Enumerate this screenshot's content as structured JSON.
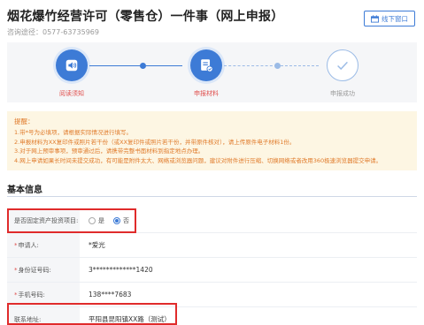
{
  "header": {
    "title": "烟花爆竹经营许可（零售仓）一件事（网上申报）",
    "consult_label": "咨询途径：",
    "consult_phone": "0577-63735969",
    "offline_button": "线下窗口"
  },
  "steps": [
    {
      "label": "阅读须知",
      "state": "done",
      "icon": "speaker-icon"
    },
    {
      "label": "申报材料",
      "state": "done",
      "icon": "document-edit-icon"
    },
    {
      "label": "申报成功",
      "state": "pending",
      "icon": "check-icon"
    }
  ],
  "notice": {
    "heading": "提醒：",
    "lines": [
      "1.带*号为必填项，请根据实际情况进行填写。",
      "2.申报材料为XX复印件或照片若干份（或XX复印件或照片若干份，并带原件核对），请上传原件电子材料1份。",
      "3.对于网上预审事项，预审通过后，请携带完整书面材料到指定地点办理。",
      "4.网上申请如果长时间未提交成功，有可能是附件太大、网络或浏览器问题，建议对附件进行压缩、切换网络或者改用360极速浏览器提交申请。"
    ]
  },
  "section": {
    "title": "基本信息"
  },
  "form": {
    "fixed_asset_label": "是否固定资产投资项目:",
    "option_yes": "是",
    "option_no": "否",
    "selected": "否",
    "applicant_label": "申请人:",
    "applicant_value": "*爱光",
    "id_label": "身份证号码:",
    "id_value": "3*************1420",
    "phone_label": "手机号码:",
    "phone_value": "138****7683",
    "address_label": "联系地址:",
    "address_value": "平阳县昆阳镇XX路（测试）"
  },
  "colors": {
    "accent": "#3d7bd6",
    "highlight": "#e02b2b",
    "notice_text": "#e07b2b",
    "required": "#e0504e"
  }
}
